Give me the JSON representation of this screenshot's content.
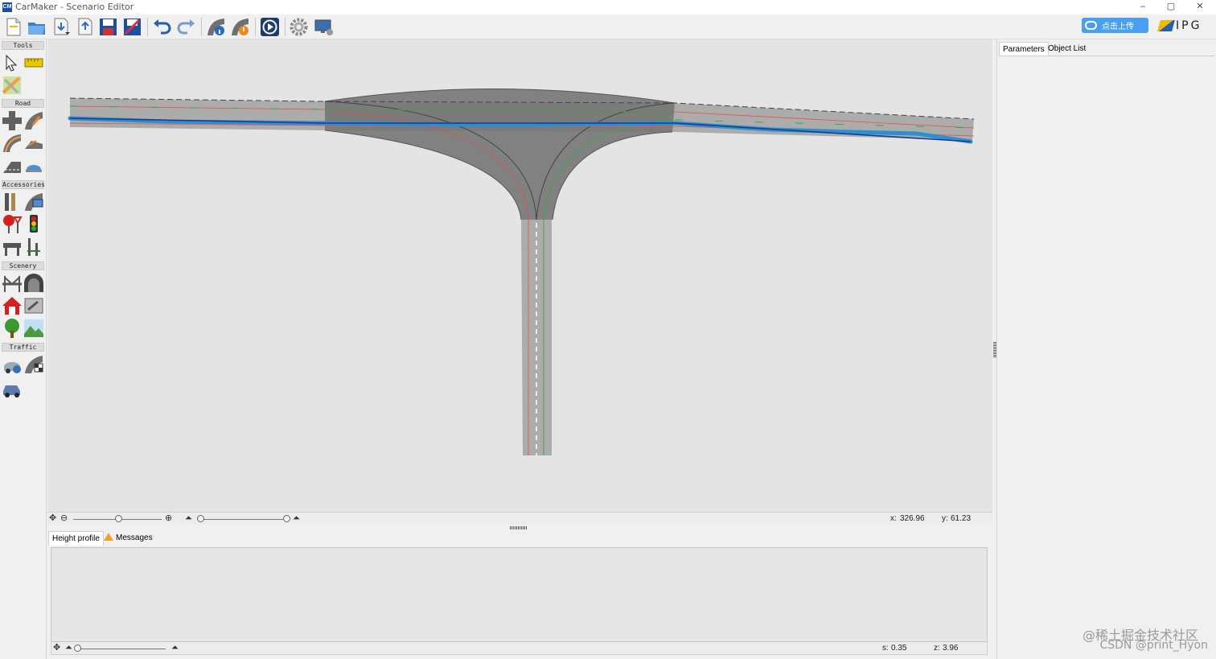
{
  "window": {
    "title": "CarMaker - Scenario Editor",
    "logo_text": "CM",
    "controls": [
      "–",
      "▢",
      "✕"
    ]
  },
  "toolbar": {
    "buttons": [
      "new-file-icon",
      "open-folder-icon",
      "import-icon",
      "export-icon",
      "save-icon",
      "save-as-icon",
      "undo-icon",
      "redo-icon",
      "road-info-icon",
      "road-check-icon",
      "play-icon",
      "settings-icon",
      "monitor-icon"
    ],
    "upload_label": "点击上传",
    "brand": "IPG"
  },
  "palette": {
    "sections": [
      "Tools",
      "Road",
      "Accessories",
      "Scenery",
      "Traffic"
    ]
  },
  "scene": {
    "zoom_in": "⊕",
    "zoom_out": "⊖",
    "coords": {
      "x_label": "x:",
      "x_value": "326.96",
      "y_label": "y:",
      "y_value": "61.23"
    }
  },
  "bottom": {
    "tabs": [
      "Height profile",
      "Messages"
    ],
    "status": {
      "s_label": "s:",
      "s_value": "0.35",
      "z_label": "z:",
      "z_value": "3.96"
    }
  },
  "right_panel": {
    "tabs": [
      "Parameters",
      "Object List"
    ]
  },
  "watermark": {
    "line1": "@稀土掘金技术社区",
    "line2": "CSDN @print_Hyon"
  },
  "colors": {
    "road": "#9c9c9c",
    "junction": "#6e6e6e",
    "route": "#2b8fd0",
    "lane_red": "#e05050",
    "lane_green": "#3ea64a",
    "canvas": "#e4e4e4"
  }
}
